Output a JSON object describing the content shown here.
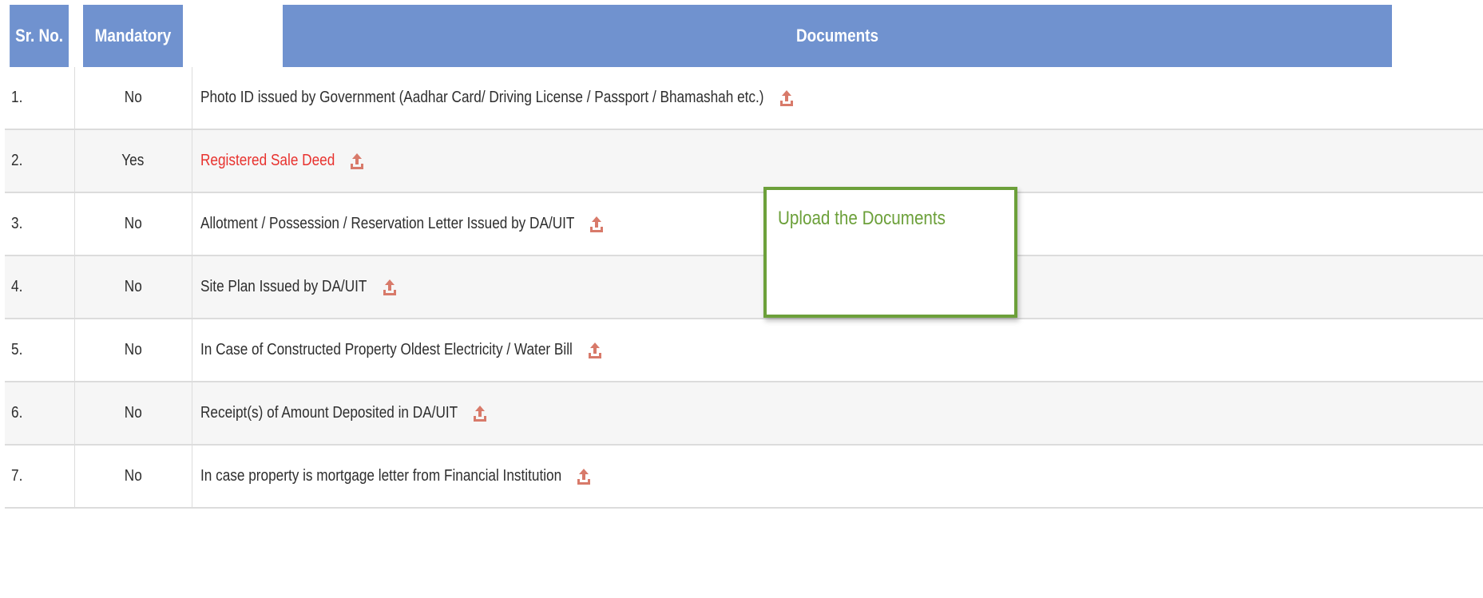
{
  "table": {
    "headers": {
      "sr_no": "Sr. No.",
      "mandatory": "Mandatory",
      "documents": "Documents"
    },
    "rows": [
      {
        "sr": "1.",
        "mandatory": "No",
        "document": "Photo ID issued by Government (Aadhar Card/ Driving License / Passport / Bhamashah etc.)",
        "required": false
      },
      {
        "sr": "2.",
        "mandatory": "Yes",
        "document": "Registered Sale Deed",
        "required": true
      },
      {
        "sr": "3.",
        "mandatory": "No",
        "document": "Allotment / Possession / Reservation Letter Issued by DA/UIT",
        "required": false
      },
      {
        "sr": "4.",
        "mandatory": "No",
        "document": "Site Plan Issued by DA/UIT",
        "required": false
      },
      {
        "sr": "5.",
        "mandatory": "No",
        "document": "In Case of Constructed Property Oldest Electricity / Water Bill",
        "required": false
      },
      {
        "sr": "6.",
        "mandatory": "No",
        "document": "Receipt(s) of Amount Deposited in DA/UIT",
        "required": false
      },
      {
        "sr": "7.",
        "mandatory": "No",
        "document": "In case property is mortgage letter from Financial Institution",
        "required": false
      }
    ],
    "upload_icon": "upload-icon"
  },
  "tooltip": {
    "text": "Upload the Documents"
  },
  "colors": {
    "header_bg": "#7092cf",
    "required_text": "#e8322e",
    "icon": "#d87a6a",
    "tooltip_border": "#6ca03a"
  }
}
